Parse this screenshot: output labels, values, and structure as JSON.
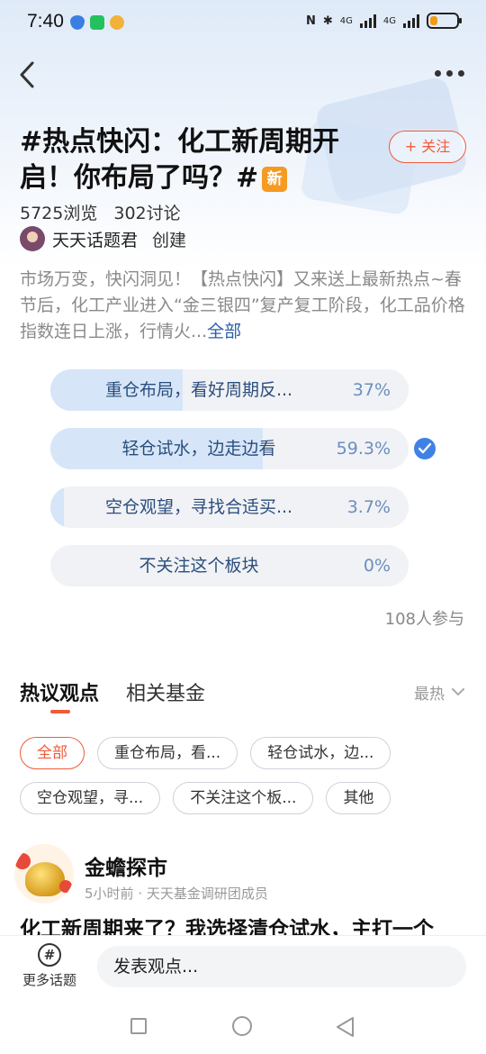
{
  "status_bar": {
    "time": "7:40",
    "network1": "4G",
    "network2": "4G"
  },
  "topic": {
    "title": "#热点快闪：化工新周期开启！你布局了吗？#",
    "new_badge": "新",
    "follow_label": "+ 关注",
    "views": "5725浏览",
    "discussions": "302讨论",
    "creator_name": "天天话题君",
    "creator_action": "创建",
    "description": "市场万变，快闪洞见！【热点快闪】又来送上最新热点~春节后，化工产业进入“金三银四”复产复工阶段，化工品价格指数连日上涨，行情火...",
    "description_more": "全部"
  },
  "poll": {
    "options": [
      {
        "label": "重仓布局，看好周期反...",
        "percent": "37%",
        "value": 0.37
      },
      {
        "label": "轻仓试水，边走边看",
        "percent": "59.3%",
        "value": 0.593,
        "selected": true
      },
      {
        "label": "空仓观望，寻找合适买...",
        "percent": "3.7%",
        "value": 0.037
      },
      {
        "label": "不关注这个板块",
        "percent": "0%",
        "value": 0
      }
    ],
    "participants": "108人参与"
  },
  "tabs": [
    {
      "label": "热议观点"
    },
    {
      "label": "相关基金"
    }
  ],
  "sort_label": "最热",
  "filters": {
    "row1": [
      "全部",
      "重仓布局，看...",
      "轻仓试水，边..."
    ],
    "row2": [
      "空仓观望，寻...",
      "不关注这个板...",
      "其他"
    ]
  },
  "post": {
    "author": "金蟾探市",
    "time": "5小时前",
    "role": "天天基金调研团成员",
    "title": "化工新周期来了？我选择清仓试水，主打一个"
  },
  "bottom": {
    "more_topics": "更多话题",
    "input_placeholder": "发表观点..."
  },
  "colors": {
    "accent": "#ef5b3a",
    "poll_fill": "#d6e6f8",
    "check": "#3f82e4",
    "badge": "#f59a23"
  }
}
